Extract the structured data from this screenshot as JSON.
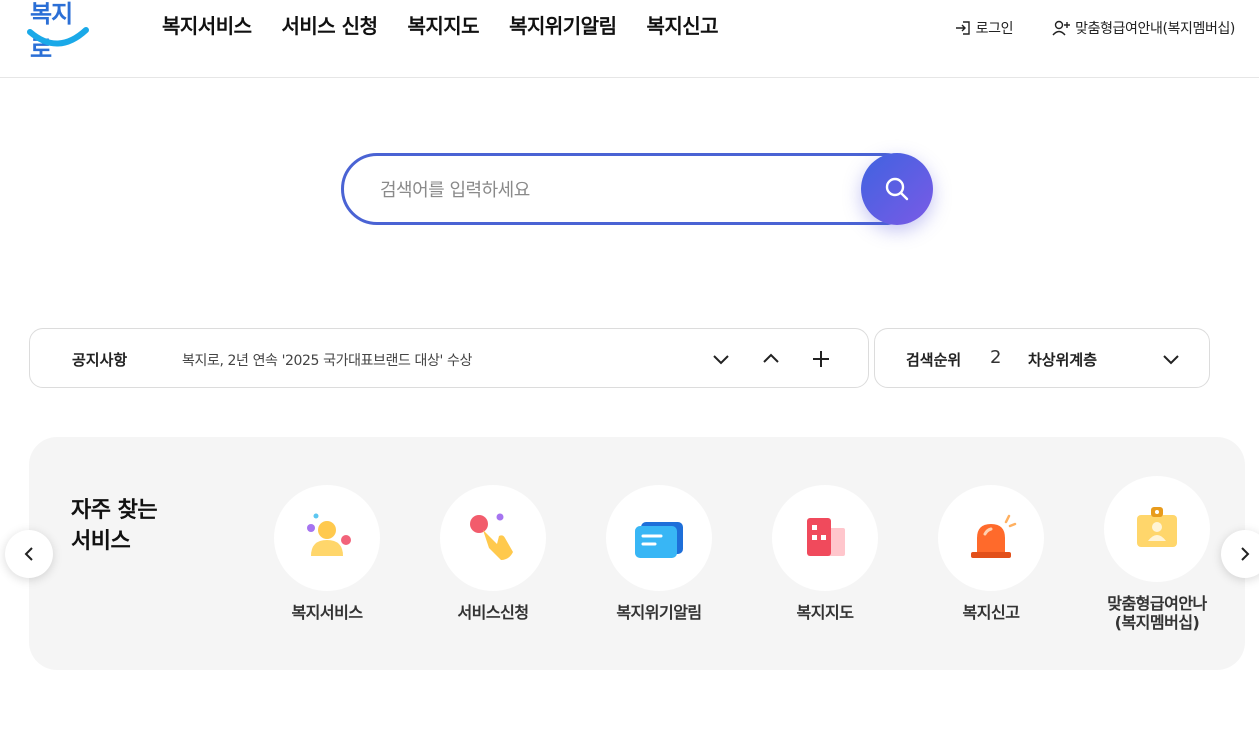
{
  "header": {
    "logo_text": "복지로",
    "nav": [
      "복지서비스",
      "서비스 신청",
      "복지지도",
      "복지위기알림",
      "복지신고"
    ],
    "login_label": "로그인",
    "membership_label": "맞춤형급여안내(복지멤버십)"
  },
  "search": {
    "placeholder": "검색어를 입력하세요"
  },
  "notice": {
    "title": "공지사항",
    "text": "복지로, 2년 연속 '2025 국가대표브랜드 대상' 수상"
  },
  "ranking": {
    "title": "검색순위",
    "rank": "2",
    "keyword": "차상위계층"
  },
  "frequent": {
    "title_line1": "자주 찾는",
    "title_line2": "서비스",
    "items": [
      {
        "label": "복지서비스",
        "icon": "people-icon"
      },
      {
        "label": "서비스신청",
        "icon": "hand-tap-icon"
      },
      {
        "label": "복지위기알림",
        "icon": "message-icon"
      },
      {
        "label": "복지지도",
        "icon": "building-map-icon"
      },
      {
        "label": "복지신고",
        "icon": "siren-icon"
      },
      {
        "label_line1": "맞춤형급여안나",
        "label_line2": "(복지멤버십)",
        "icon": "id-card-icon"
      }
    ]
  },
  "colors": {
    "brand_blue": "#4a63d4",
    "logo_cyan": "#1aa9e8"
  }
}
